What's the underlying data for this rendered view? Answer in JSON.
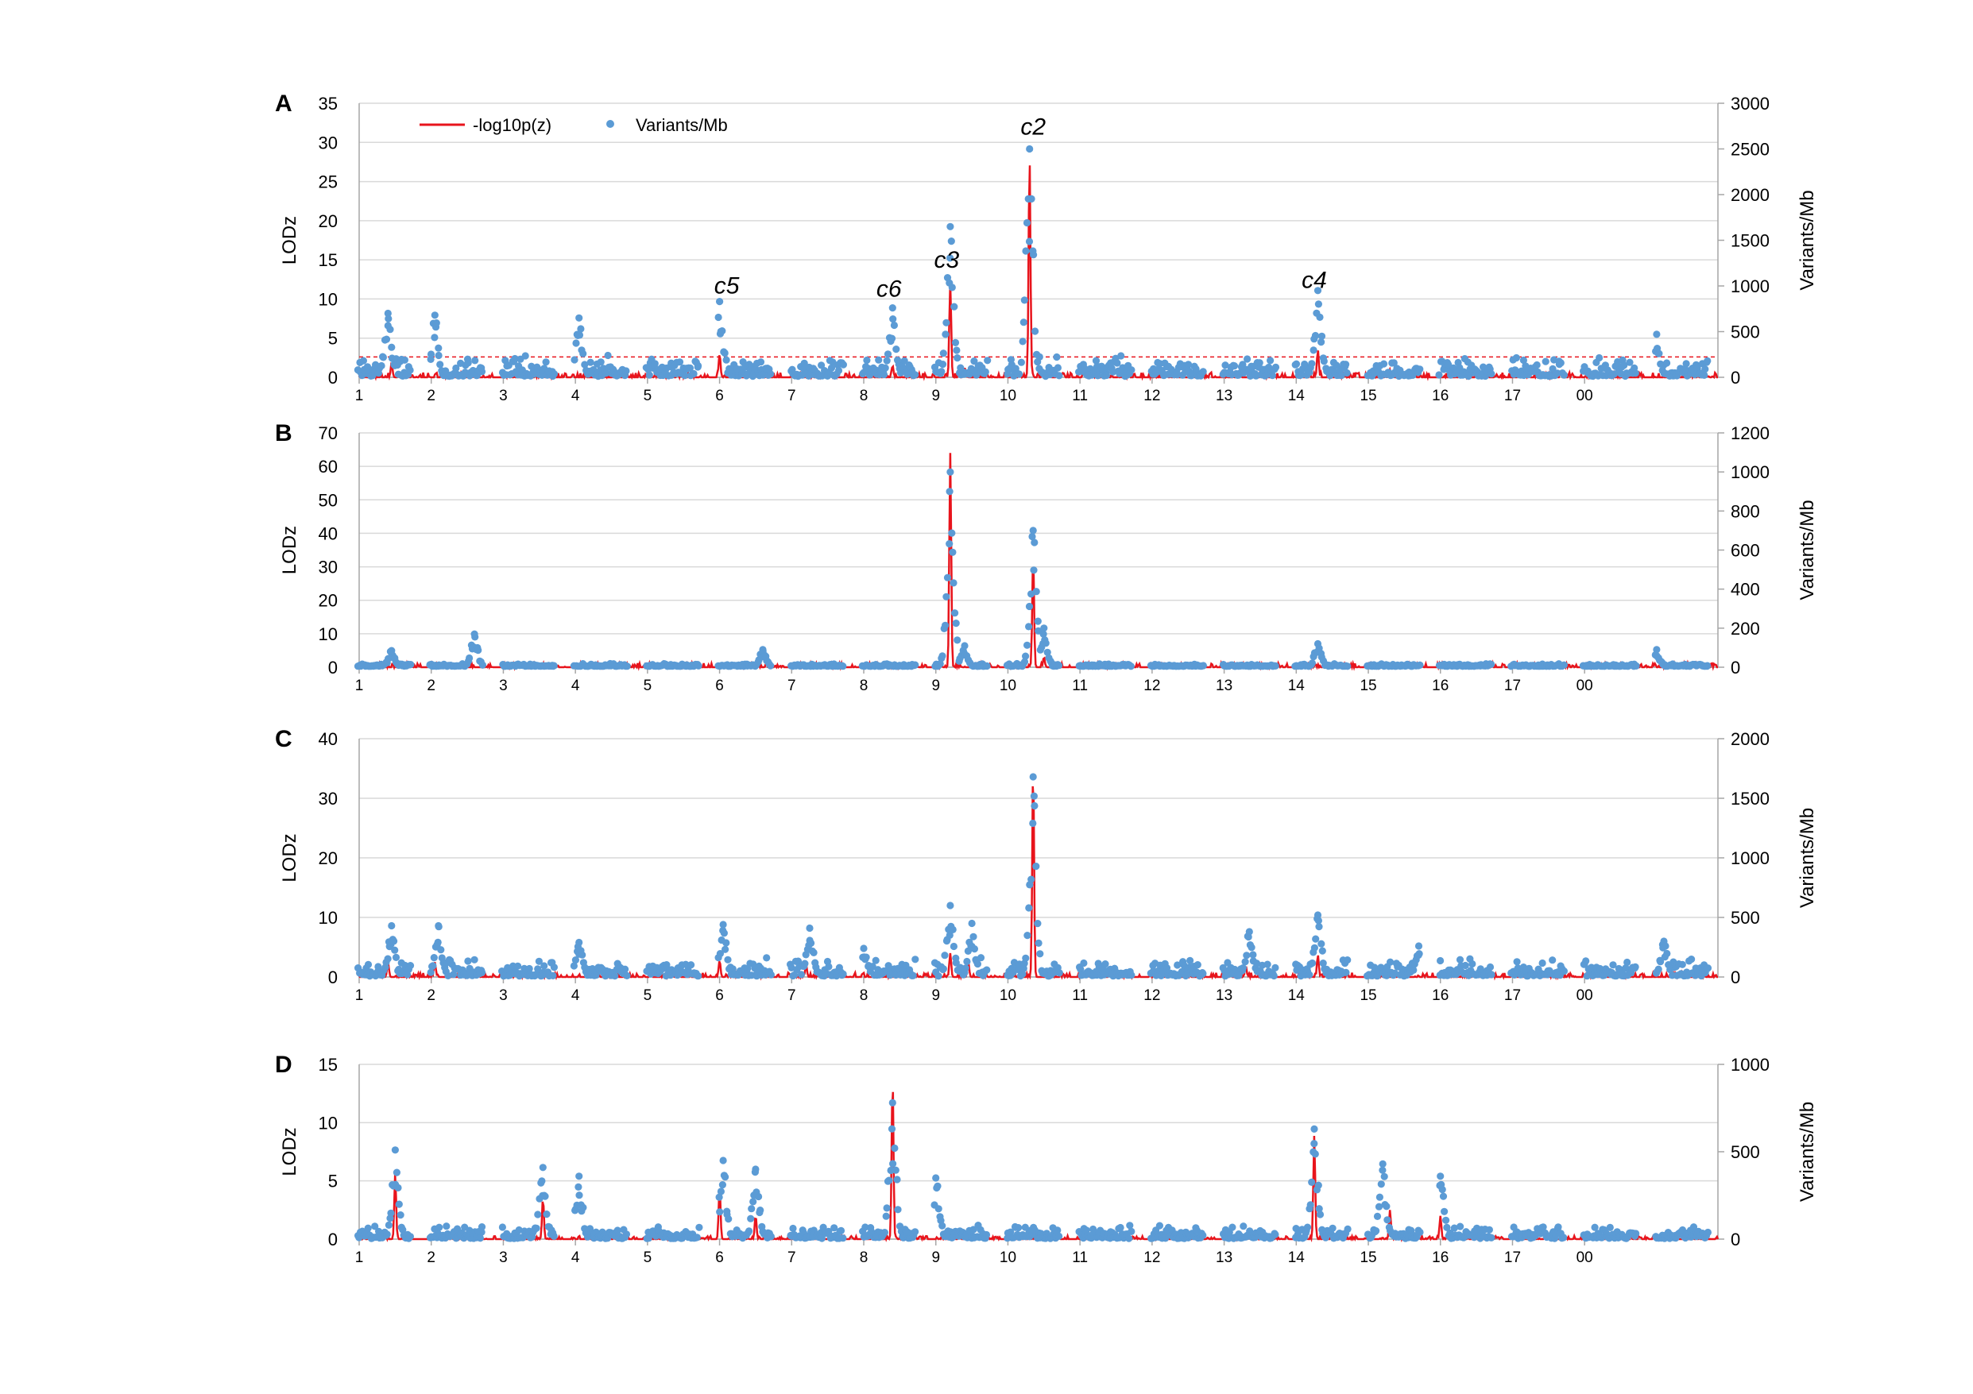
{
  "chart_data": [
    {
      "type": "line",
      "panel_label": "A",
      "ylabel": "LODz",
      "y2label": "Variants/Mb",
      "ylim": [
        0,
        35
      ],
      "yticks": [
        0,
        5,
        10,
        15,
        20,
        25,
        30,
        35
      ],
      "y2lim": [
        0,
        3000
      ],
      "y2ticks": [
        0,
        500,
        1000,
        1500,
        2000,
        2500,
        3000
      ],
      "threshold": 2.6,
      "legend": {
        "placement": "top-left",
        "line_label": "-log10p(z)",
        "dot_label": "Variants/Mb"
      },
      "peaks": [
        {
          "x": 6.0,
          "y": 3.0
        },
        {
          "x": 6.4,
          "y": 1.2
        },
        {
          "x": 1.45,
          "y": 1.8
        },
        {
          "x": 8.4,
          "y": 1.5
        },
        {
          "x": 9.2,
          "y": 12.2
        },
        {
          "x": 9.4,
          "y": 1.2
        },
        {
          "x": 10.3,
          "y": 28.3
        },
        {
          "x": 10.55,
          "y": 0.8
        },
        {
          "x": 14.3,
          "y": 3.5
        },
        {
          "x": 15.3,
          "y": 1.0
        }
      ],
      "variants_peaks": [
        {
          "x": 1.4,
          "y": 700
        },
        {
          "x": 2.05,
          "y": 680
        },
        {
          "x": 4.05,
          "y": 650
        },
        {
          "x": 6.0,
          "y": 830
        },
        {
          "x": 8.4,
          "y": 760
        },
        {
          "x": 9.2,
          "y": 1650
        },
        {
          "x": 10.3,
          "y": 2500
        },
        {
          "x": 14.3,
          "y": 950
        },
        {
          "x": 19.0,
          "y": 470
        }
      ],
      "annotations": [
        {
          "text": "c2",
          "x": 10.35,
          "y": 31.0
        },
        {
          "text": "c3",
          "x": 9.15,
          "y": 14.0
        },
        {
          "text": "c5",
          "x": 6.1,
          "y": 10.7
        },
        {
          "text": "c6",
          "x": 8.35,
          "y": 10.3
        },
        {
          "text": "c4",
          "x": 14.25,
          "y": 11.4
        }
      ]
    },
    {
      "type": "line",
      "panel_label": "B",
      "ylabel": "LODz",
      "y2label": "Variants/Mb",
      "ylim": [
        0,
        70
      ],
      "yticks": [
        0,
        10,
        20,
        30,
        40,
        50,
        60,
        70
      ],
      "y2lim": [
        0,
        1200
      ],
      "y2ticks": [
        0,
        200,
        400,
        600,
        800,
        1000,
        1200
      ],
      "peaks": [
        {
          "x": 9.2,
          "y": 64
        },
        {
          "x": 10.35,
          "y": 33
        },
        {
          "x": 10.5,
          "y": 3
        }
      ],
      "variants_peaks": [
        {
          "x": 1.45,
          "y": 85
        },
        {
          "x": 2.6,
          "y": 170
        },
        {
          "x": 6.6,
          "y": 90
        },
        {
          "x": 9.2,
          "y": 1000
        },
        {
          "x": 10.35,
          "y": 700
        },
        {
          "x": 10.5,
          "y": 200
        },
        {
          "x": 9.4,
          "y": 110
        },
        {
          "x": 14.3,
          "y": 120
        },
        {
          "x": 19.0,
          "y": 90
        }
      ]
    },
    {
      "type": "line",
      "panel_label": "C",
      "ylabel": "LODz",
      "y2label": "Variants/Mb",
      "ylim": [
        0,
        40
      ],
      "yticks": [
        0,
        10,
        20,
        30,
        40
      ],
      "y2lim": [
        0,
        2000
      ],
      "y2ticks": [
        0,
        500,
        1000,
        1500,
        2000
      ],
      "peaks": [
        {
          "x": 1.4,
          "y": 2.5
        },
        {
          "x": 2.05,
          "y": 2.5
        },
        {
          "x": 6.0,
          "y": 2.8
        },
        {
          "x": 7.2,
          "y": 2.0
        },
        {
          "x": 9.2,
          "y": 4.0
        },
        {
          "x": 9.45,
          "y": 2.5
        },
        {
          "x": 10.35,
          "y": 35.5
        },
        {
          "x": 13.3,
          "y": 1.8
        },
        {
          "x": 14.3,
          "y": 3.7
        }
      ],
      "variants_peaks": [
        {
          "x": 1.45,
          "y": 430
        },
        {
          "x": 2.1,
          "y": 430
        },
        {
          "x": 4.05,
          "y": 290
        },
        {
          "x": 6.05,
          "y": 440
        },
        {
          "x": 7.25,
          "y": 410
        },
        {
          "x": 8.0,
          "y": 240
        },
        {
          "x": 9.2,
          "y": 600
        },
        {
          "x": 9.5,
          "y": 450
        },
        {
          "x": 10.35,
          "y": 1680
        },
        {
          "x": 13.35,
          "y": 380
        },
        {
          "x": 14.3,
          "y": 520
        },
        {
          "x": 15.7,
          "y": 260
        },
        {
          "x": 19.1,
          "y": 300
        }
      ]
    },
    {
      "type": "line",
      "panel_label": "D",
      "ylabel": "LODz",
      "y2label": "Variants/Mb",
      "ylim": [
        0,
        15
      ],
      "yticks": [
        0,
        5,
        10,
        15
      ],
      "y2lim": [
        0,
        1000
      ],
      "y2ticks": [
        0,
        500,
        1000
      ],
      "peaks": [
        {
          "x": 1.5,
          "y": 5.6
        },
        {
          "x": 3.55,
          "y": 3.5
        },
        {
          "x": 6.0,
          "y": 4.5
        },
        {
          "x": 8.4,
          "y": 13.8
        },
        {
          "x": 14.25,
          "y": 8.9
        },
        {
          "x": 15.3,
          "y": 2.5
        },
        {
          "x": 16.0,
          "y": 2.0
        },
        {
          "x": 6.5,
          "y": 2.0
        }
      ],
      "variants_peaks": [
        {
          "x": 1.5,
          "y": 510
        },
        {
          "x": 3.55,
          "y": 410
        },
        {
          "x": 4.05,
          "y": 360
        },
        {
          "x": 6.05,
          "y": 450
        },
        {
          "x": 6.5,
          "y": 400
        },
        {
          "x": 8.4,
          "y": 780
        },
        {
          "x": 9.0,
          "y": 350
        },
        {
          "x": 14.25,
          "y": 630
        },
        {
          "x": 15.2,
          "y": 430
        },
        {
          "x": 16.0,
          "y": 360
        }
      ]
    }
  ],
  "x_axis": {
    "xlim": [
      1,
      19.85
    ],
    "tick_labels": [
      "1",
      "2",
      "3",
      "4",
      "5",
      "6",
      "7",
      "8",
      "9",
      "10",
      "11",
      "12",
      "13",
      "14",
      "15",
      "16",
      "17",
      "00"
    ],
    "tick_values": [
      1,
      2,
      3,
      4,
      5,
      6,
      7,
      8,
      9,
      10,
      11,
      12,
      13,
      14,
      15,
      16,
      17,
      18
    ]
  },
  "colors": {
    "line": "#e8141c",
    "dots": "#5b9bd5",
    "threshold": "#e8141c",
    "grid": "#d9d9d9",
    "axis": "#a6a6a6"
  }
}
